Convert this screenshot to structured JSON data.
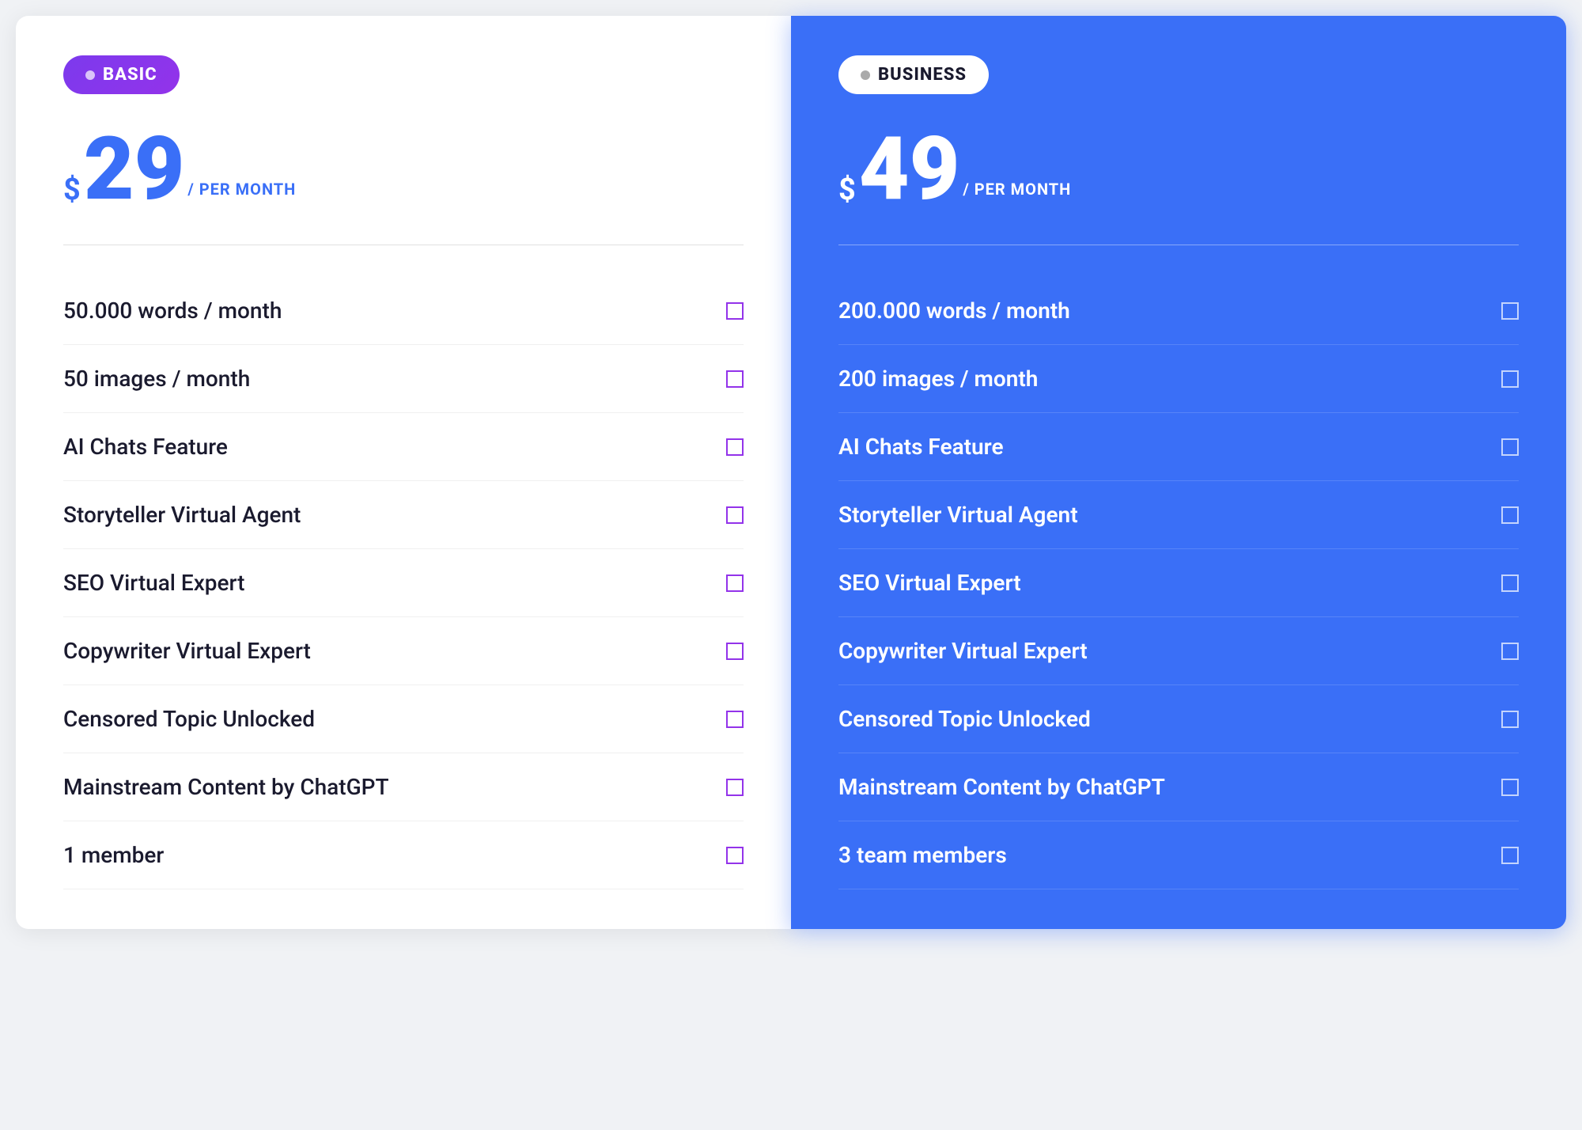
{
  "basic": {
    "badge_label": "BASIC",
    "price_dollar": "$",
    "price_amount": "29",
    "price_period": "/ PER MONTH",
    "features": [
      {
        "label": "50.000 words / month"
      },
      {
        "label": "50 images / month"
      },
      {
        "label": "AI Chats Feature"
      },
      {
        "label": "Storyteller Virtual Agent"
      },
      {
        "label": "SEO Virtual Expert"
      },
      {
        "label": "Copywriter Virtual Expert"
      },
      {
        "label": "Censored Topic Unlocked"
      },
      {
        "label": "Mainstream Content by ChatGPT"
      },
      {
        "label": "1 member"
      }
    ]
  },
  "business": {
    "badge_label": "BUSINESS",
    "price_dollar": "$",
    "price_amount": "49",
    "price_period": "/ PER MONTH",
    "features": [
      {
        "label": "200.000 words / month"
      },
      {
        "label": "200 images / month"
      },
      {
        "label": "AI Chats Feature"
      },
      {
        "label": "Storyteller Virtual Agent"
      },
      {
        "label": "SEO Virtual Expert"
      },
      {
        "label": "Copywriter Virtual Expert"
      },
      {
        "label": "Censored Topic Unlocked"
      },
      {
        "label": "Mainstream Content by ChatGPT"
      },
      {
        "label": "3 team members"
      }
    ]
  }
}
